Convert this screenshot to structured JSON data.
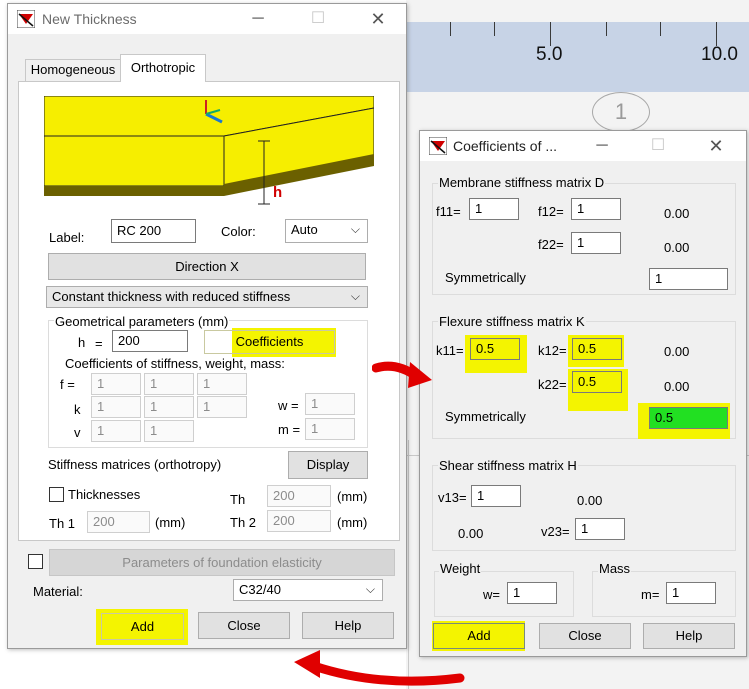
{
  "background": {
    "ruler_labels": [
      "5.0",
      "10.0"
    ],
    "node_label": "1"
  },
  "thickness_dialog": {
    "title": "New Thickness",
    "tabs": [
      "Homogeneous",
      "Orthotropic"
    ],
    "diagram_label": "h",
    "label_caption": "Label:",
    "label_value": "RC 200",
    "color_caption": "Color:",
    "color_value": "Auto",
    "direction_button": "Direction X",
    "thickness_type": "Constant thickness with reduced stiffness",
    "geom_caption": "Geometrical parameters (mm)",
    "h_caption": "h",
    "h_eq": "=",
    "h_value": "200",
    "coefficients_button": "Coefficients",
    "coef_caption": "Coefficients of stiffness, weight, mass:",
    "f_label": "f =",
    "f_values": [
      "1",
      "1",
      "1"
    ],
    "k_label": "k",
    "k_values": [
      "1",
      "1",
      "1"
    ],
    "v_label": "v",
    "v_values": [
      "1",
      "1"
    ],
    "w_label": "w =",
    "w_value": "1",
    "m_label": "m =",
    "m_value": "1",
    "stiff_matrices_caption": "Stiffness matrices (orthotropy)",
    "display_button": "Display",
    "thicknesses_checkbox": "Thicknesses",
    "th_label": "Th",
    "th_value": "200",
    "th_unit": "(mm)",
    "th1_label": "Th 1",
    "th1_value": "200",
    "th1_unit": "(mm)",
    "th2_label": "Th 2",
    "th2_value": "200",
    "th2_unit": "(mm)",
    "foundation_button": "Parameters of foundation elasticity",
    "material_caption": "Material:",
    "material_value": "C32/40",
    "add_button": "Add",
    "close_button": "Close",
    "help_button": "Help"
  },
  "coefficients_dialog": {
    "title": "Coefficients of ...",
    "membrane_caption": "Membrane stiffness matrix D",
    "f11_label": "f11=",
    "f11_value": "1",
    "f12_label": "f12=",
    "f12_value": "1",
    "f_zero1": "0.00",
    "f22_label": "f22=",
    "f22_value": "1",
    "f_zero2": "0.00",
    "membrane_sym_label": "Symmetrically",
    "membrane_sym_value": "1",
    "flexure_caption": "Flexure stiffness matrix K",
    "k11_label": "k11=",
    "k11_value": "0.5",
    "k12_label": "k12=",
    "k12_value": "0.5",
    "k_zero1": "0.00",
    "k22_label": "k22=",
    "k22_value": "0.5",
    "k_zero2": "0.00",
    "flexure_sym_label": "Symmetrically",
    "flexure_sym_value": "0.5",
    "shear_caption": "Shear stiffness matrix H",
    "v13_label": "v13=",
    "v13_value": "1",
    "v_zero1": "0.00",
    "v_zero2": "0.00",
    "v23_label": "v23=",
    "v23_value": "1",
    "weight_caption": "Weight",
    "w_label": "w=",
    "w_value": "1",
    "mass_caption": "Mass",
    "m_label": "m=",
    "m_value": "1",
    "add_button": "Add",
    "close_button": "Close",
    "help_button": "Help"
  },
  "colors": {
    "highlight_yellow": "#f4f400",
    "highlight_green": "#22e022",
    "annotation_red": "#e00000",
    "slab_yellow": "#f6ee00",
    "slab_olive": "#6b6000"
  }
}
